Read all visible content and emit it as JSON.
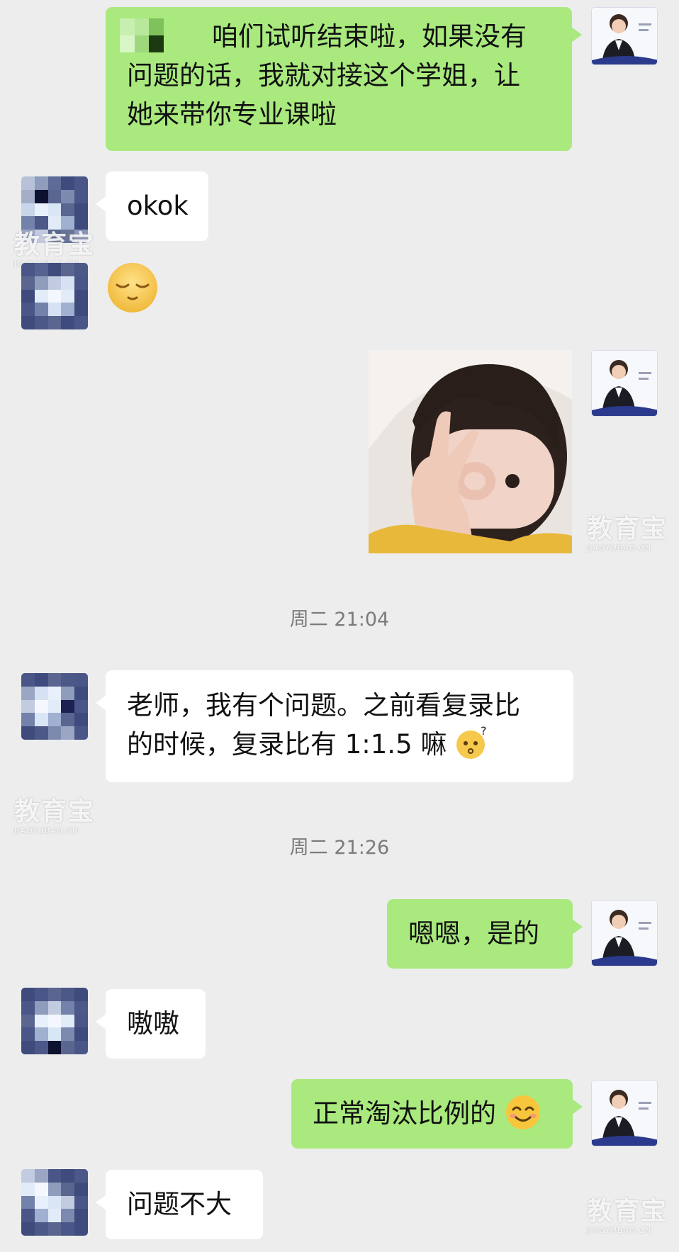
{
  "messages": [
    {
      "text": "咱们试听结束啦，如果没有问题的话，我就对接这个学姐，让她来带你专业课啦"
    },
    {
      "text": "okok"
    },
    {
      "text": ""
    },
    {
      "text": ""
    },
    {
      "text": "老师，我有个问题。之前看复录比的时候，复录比有 1:1.5 嘛"
    },
    {
      "text": "嗯嗯，是的"
    },
    {
      "text": "嗷嗷"
    },
    {
      "text": "正常淘汰比例的"
    },
    {
      "text": "问题不大"
    }
  ],
  "line1a": "咱们试听结束啦，如果没有",
  "line1b": "问题的话，我就对接这个学姐，让",
  "line1c": "她来带你专业课啦",
  "line5a": "老师，我有个问题。之前看复录比",
  "line5b": "的时候，复录比有 1:1.5 嘛",
  "timestamps": [
    "周二 21:04",
    "周二 21:26"
  ],
  "watermark": {
    "main": "教育宝",
    "sub": "JIAOYUBAO.CN"
  },
  "icons": [
    "sleepy-face-emoji",
    "thinking-face-emoji",
    "smiling-face-emoji",
    "ok-gesture-photo"
  ]
}
